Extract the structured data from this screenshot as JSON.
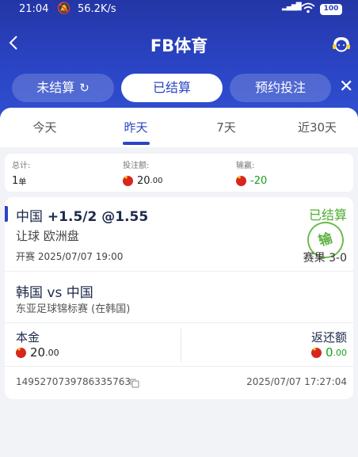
{
  "status": {
    "time": "21:04",
    "speed": "56.2K/s",
    "signal": "HD",
    "battery": "100"
  },
  "header": {
    "title": "FB体育"
  },
  "segments": [
    {
      "label": "未结算"
    },
    {
      "label": "已结算"
    },
    {
      "label": "预约投注"
    }
  ],
  "tabs": [
    {
      "label": "今天"
    },
    {
      "label": "昨天"
    },
    {
      "label": "7天"
    },
    {
      "label": "近30天"
    }
  ],
  "summary": {
    "total_label": "总计:",
    "total_value": "1",
    "total_unit": "单",
    "stake_label": "投注额:",
    "stake_int": "20",
    "stake_dec": ".00",
    "winloss_label": "输赢:",
    "winloss_value": "-20"
  },
  "bet": {
    "selection": "中国",
    "line": "+1.5/2 @1.55",
    "status": "已结算",
    "market": "让球 欧洲盘",
    "kickoff": "开赛 2025/07/07 19:00",
    "result_stamp": "输",
    "score": "赛果 3-0",
    "match": "韩国 vs 中国",
    "league": "东亚足球锦标赛 (在韩国)",
    "stake_label": "本金",
    "stake_int": "20",
    "stake_dec": ".00",
    "return_label": "返还额",
    "return_int": "0",
    "return_dec": ".00",
    "order_id": "1495270739786335763",
    "bet_time": "2025/07/07 17:27:04"
  },
  "colors": {
    "brand": "#2a44c4",
    "win": "#4cae2e",
    "loss": "#1aa21a"
  }
}
